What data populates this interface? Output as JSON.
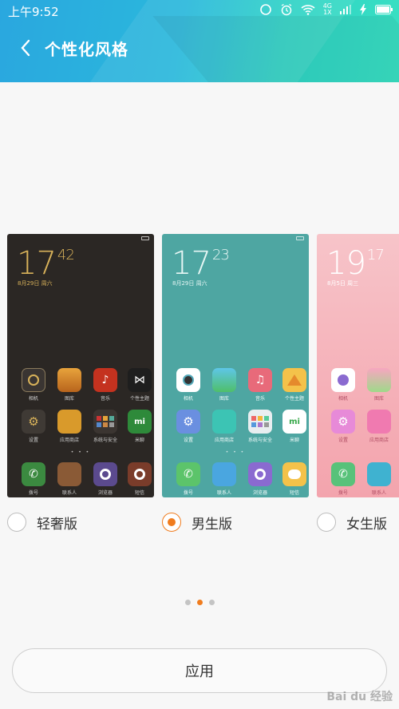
{
  "status_bar": {
    "time": "上午9:52",
    "network_top": "4G",
    "network_bottom": "1X"
  },
  "titlebar": {
    "title": "个性化风格"
  },
  "themes": [
    {
      "clock_h": "17",
      "clock_m": "42",
      "date": "8月29日 周六",
      "row1": [
        "相机",
        "图库",
        "音乐",
        "个性主题"
      ],
      "row2": [
        "设置",
        "应用商店",
        "系统与安全",
        "米聊"
      ],
      "dock": [
        "拨号",
        "联系人",
        "浏览器",
        "短信"
      ],
      "dots": "• • •"
    },
    {
      "clock_h": "17",
      "clock_m": "23",
      "date": "8月29日 周六",
      "row1": [
        "相机",
        "图库",
        "音乐",
        "个性主题"
      ],
      "row2": [
        "设置",
        "应用商店",
        "系统与安全",
        "米聊"
      ],
      "dock": [
        "拨号",
        "联系人",
        "浏览器",
        "短信"
      ],
      "dots": "• • •"
    },
    {
      "clock_h": "19",
      "clock_m": "17",
      "date": "8月5日 周三",
      "row1": [
        "相机",
        "图库"
      ],
      "row2": [
        "设置",
        "应用商店"
      ],
      "dock": [
        "拨号",
        "联系人"
      ]
    }
  ],
  "options": [
    {
      "label": "轻奢版",
      "selected": false
    },
    {
      "label": "男生版",
      "selected": true
    },
    {
      "label": "女生版",
      "selected": false
    }
  ],
  "apply_button": {
    "label": "应用"
  },
  "watermark": "Bai du 经验",
  "colors": {
    "accent": "#f07c1e",
    "header_start": "#2aa7df",
    "header_end": "#39e0c2"
  }
}
